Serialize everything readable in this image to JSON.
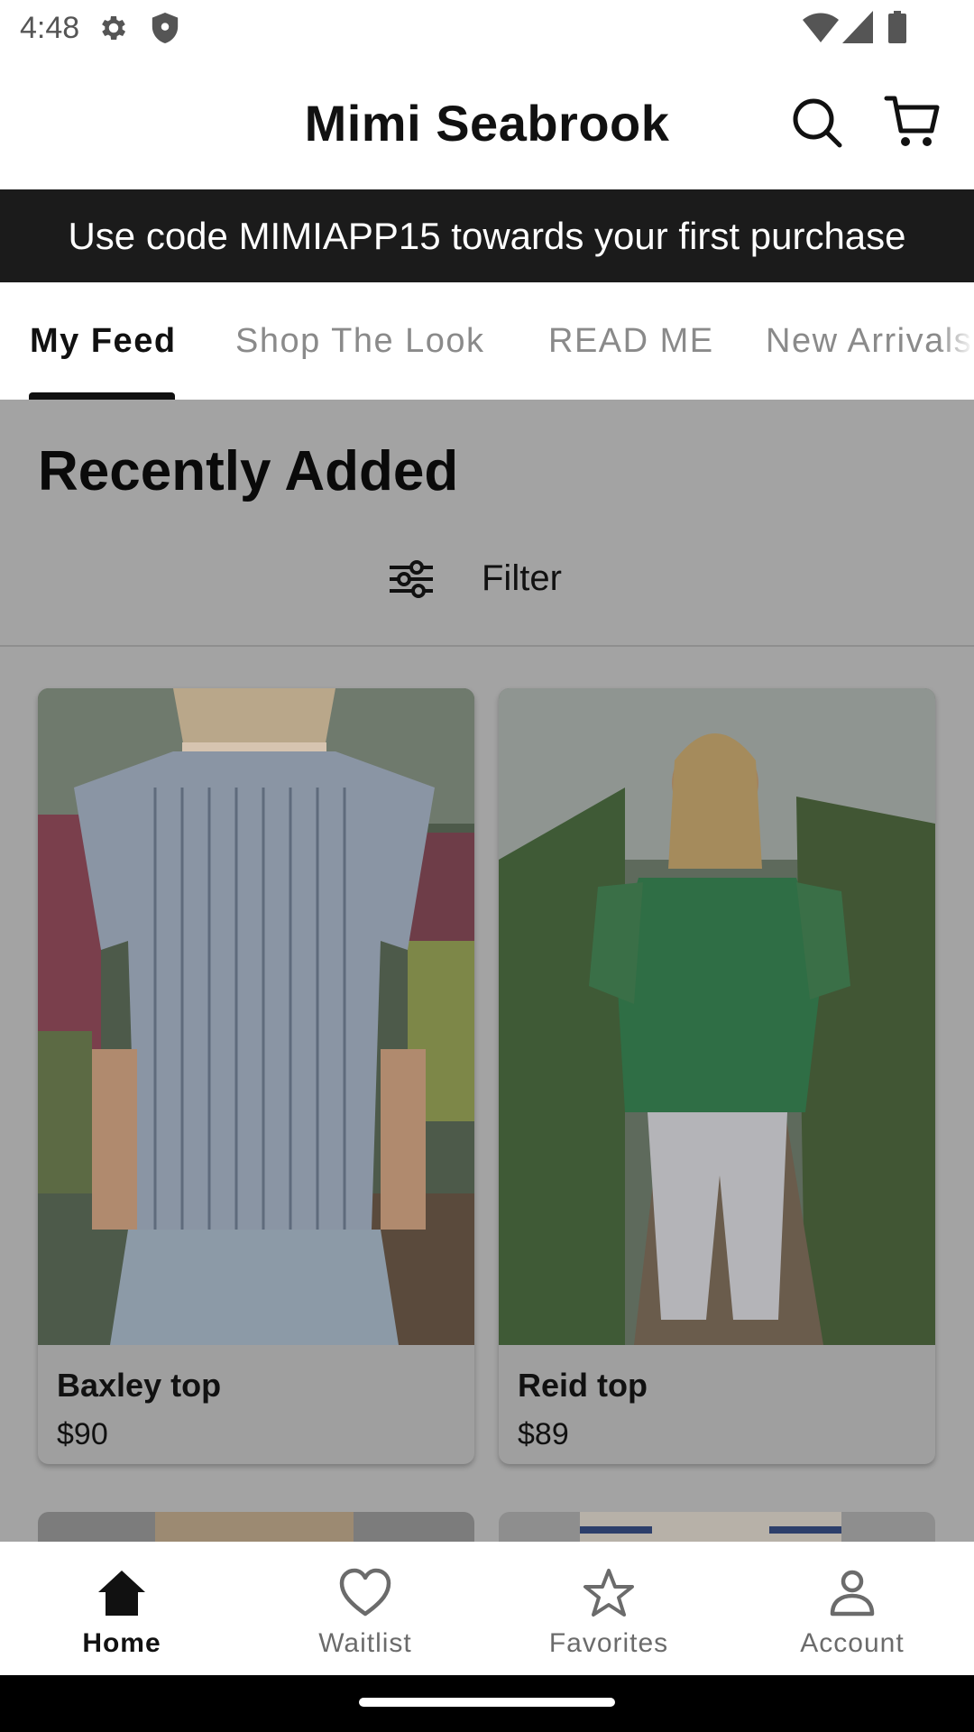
{
  "status_bar": {
    "time": "4:48",
    "icons": [
      "gear-icon",
      "shield-icon",
      "wifi-icon",
      "cell-signal-icon",
      "battery-icon"
    ]
  },
  "header": {
    "title": "Mimi Seabrook",
    "icons": [
      "search-icon",
      "shopping-cart-icon"
    ]
  },
  "promo": {
    "text": "Use code MIMIAPP15 towards your first purchase"
  },
  "tabs": [
    {
      "label": "My Feed",
      "active": true
    },
    {
      "label": "Shop The Look",
      "active": false
    },
    {
      "label": "READ ME",
      "active": false
    },
    {
      "label": "New Arrivals",
      "active": false
    }
  ],
  "main": {
    "section_title": "Recently Added",
    "filter_label": "Filter",
    "filter_icon": "sliders-icon",
    "products": [
      {
        "name": "Baxley top",
        "price": "$90"
      },
      {
        "name": "Reid top",
        "price": "$89"
      }
    ]
  },
  "bottom_nav": {
    "items": [
      {
        "label": "Home",
        "icon": "home-icon",
        "active": true
      },
      {
        "label": "Waitlist",
        "icon": "heart-icon",
        "active": false
      },
      {
        "label": "Favorites",
        "icon": "star-icon",
        "active": false
      },
      {
        "label": "Account",
        "icon": "person-icon",
        "active": false
      }
    ]
  },
  "colors": {
    "banner_bg": "#1b1b1b",
    "overlay_bg": "#a3a3a3",
    "text_primary": "#111111",
    "tab_inactive": "#8a8a8a"
  }
}
